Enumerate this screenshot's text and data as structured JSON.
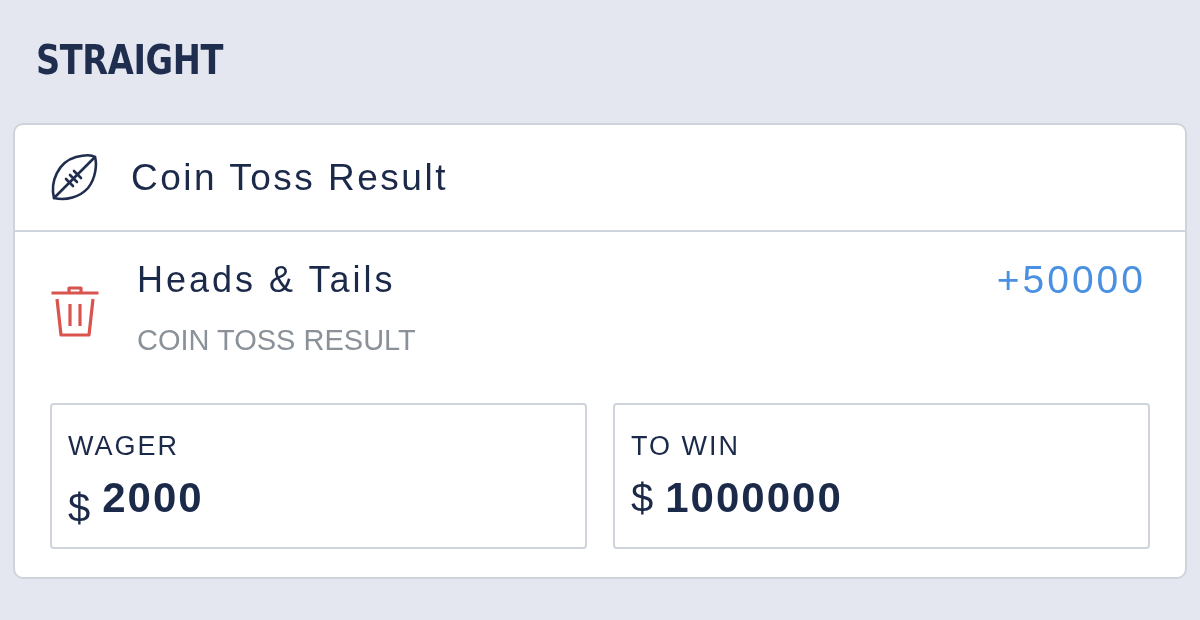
{
  "section_title": "STRAIGHT",
  "bet_slip": {
    "event": {
      "title": "Coin Toss Result"
    },
    "selection": {
      "name": "Heads & Tails",
      "market": "COIN TOSS RESULT",
      "odds": "+50000"
    },
    "amounts": [
      {
        "kind": "input",
        "label": "WAGER",
        "currency": "$",
        "value": "2000"
      },
      {
        "kind": "display",
        "label": "TO WIN",
        "currency": "$",
        "value": "1000000"
      }
    ]
  }
}
